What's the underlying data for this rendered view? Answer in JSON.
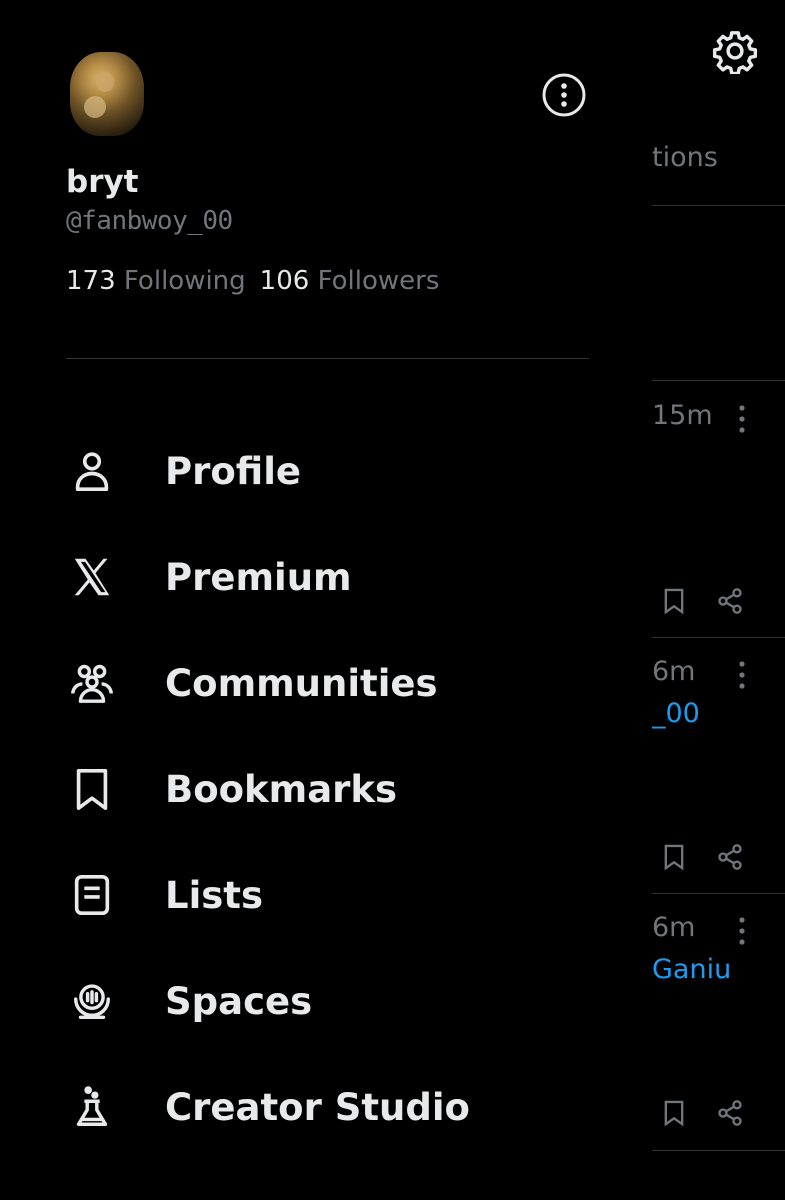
{
  "profile": {
    "display_name": "bryt",
    "handle": "@fanbwoy_00",
    "following_count": "173",
    "following_label": "Following",
    "followers_count": "106",
    "followers_label": "Followers"
  },
  "menu": [
    {
      "label": "Profile",
      "icon": "person-icon"
    },
    {
      "label": "Premium",
      "icon": "x-logo-icon"
    },
    {
      "label": "Communities",
      "icon": "communities-icon"
    },
    {
      "label": "Bookmarks",
      "icon": "bookmark-icon"
    },
    {
      "label": "Lists",
      "icon": "list-icon"
    },
    {
      "label": "Spaces",
      "icon": "spaces-icon"
    },
    {
      "label": "Creator Studio",
      "icon": "flask-icon"
    }
  ],
  "background": {
    "tab_fragment": "tions",
    "posts": [
      {
        "time": "15m",
        "handle": ""
      },
      {
        "time": "6m",
        "handle": "_00"
      },
      {
        "time": "6m",
        "handle": "Ganiu"
      }
    ]
  },
  "colors": {
    "background": "#000000",
    "primary_text": "#e7e9ea",
    "secondary_text": "#71767b",
    "divider": "#2f3336",
    "link": "#1d9bf0"
  }
}
